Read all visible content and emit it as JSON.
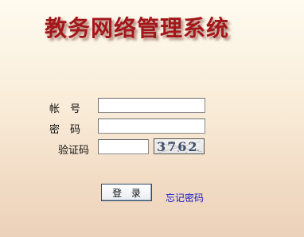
{
  "header": {
    "title": "教务网络管理系统"
  },
  "form": {
    "account_label": "帐　号",
    "account_value": "",
    "password_label": "密　码",
    "password_value": "",
    "captcha_label": "验证码",
    "captcha_value": "",
    "captcha_code": "3762"
  },
  "actions": {
    "login_label": "登 录",
    "forgot_label": "忘记密码"
  },
  "colors": {
    "title": "#a3171a",
    "link": "#1a1acb"
  }
}
